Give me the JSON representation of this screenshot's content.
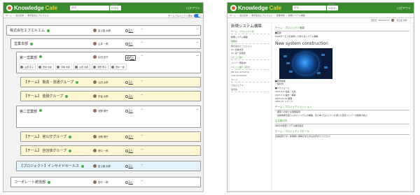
{
  "brand": {
    "name_a": "Knowledge",
    "name_b": "Cafe"
  },
  "header": {
    "search_ph": "検索",
    "filter": "組織全体検索 ▾",
    "login": "ログアウト"
  },
  "left": {
    "crumbs": [
      "ホーム",
      "会社全体",
      "株式会社エフエルエム"
    ],
    "toggle_label": "チームプロジェクト表示",
    "rows": [
      {
        "name": "株式会社エフエルエム",
        "user": "富士森 太郎",
        "count": "2人"
      },
      {
        "name": "営業本部",
        "user": "山本 一郎",
        "count": "6人"
      },
      {
        "name": "第一営業部",
        "user": "山田 花子",
        "count": "6人"
      },
      {
        "name": "【チーム】 製造・流通グループ",
        "user": "山田 太郎",
        "count": "3人"
      },
      {
        "name": "【チーム】 金融グループ",
        "user": "宇留 太郎",
        "count": "3人"
      },
      {
        "name": "第二営業部",
        "user": "河野 博子",
        "count": "3人"
      },
      {
        "name": "【チーム】 官公庁グループ",
        "user": "河野 博子",
        "count": "2人"
      },
      {
        "name": "【チーム】 自治体グループ",
        "user": "田中 一郎",
        "count": "2人"
      },
      {
        "name": "【プロジェクト】インサイドセールス",
        "user": "富士森 太郎",
        "count": "2人"
      },
      {
        "name": "コーポレート統括部",
        "user": "田中 一郎",
        "count": "3人"
      }
    ],
    "members": [
      "山田 花子",
      "田中 太郎",
      "宇留 太郎",
      "山田 太郎",
      "河野 博子",
      "田中 一郎"
    ]
  },
  "right": {
    "crumbs": [
      "ホーム",
      "会社全体",
      "株式会社エフエルエム",
      "営業本部",
      "新規システム構築"
    ],
    "meta": {
      "updated": "更新日: 2022/04/07",
      "user": "富士森 太郎"
    },
    "title": "新規システム構築",
    "side": {
      "team_lbl": "チーム・プロジェクト名",
      "team_val": "新規システム構築",
      "org_lbl": "組織名",
      "org_vals": [
        "株式会社エフエルエム",
        "(D) 営業本部",
        "(D) 第一営業部"
      ],
      "who_lbl": "ひとこと紹介",
      "member_lbl": "メンバー募集中!",
      "about_lbl": "ひとこと紹介 (英文)",
      "about_vals": [
        "We are recruiting",
        "new members!"
      ],
      "type_lbl": "タイプ",
      "type_val": "プロジェクト",
      "status_lbl": "事例等"
    },
    "main": {
      "sec1": "チーム・プロジェクト概要",
      "purpose_h": "■目的",
      "purpose": "SaaSサービスを提供した新たなシステム構築",
      "big": "New system construction",
      "period_h": "■利用技術",
      "period": "・検討中",
      "sched_h": "■スケジュール",
      "sched": [
        "2023.4-6 企画・立案",
        "2023.7-9 設計・構築",
        "2023.10-12 開発",
        "2024.01 リリース"
      ],
      "sec2": "チーム・プロジェクトミッション",
      "mission": [
        "・顧客への新たな価値提供",
        "・最新技術を取り入れたシステムの構築、及び本プロジェクトを通じた若手メンバーの技術力向上"
      ],
      "sec3": "主な取引先",
      "partner": "ABCDE情報システム株式会社",
      "sec4": "チーム・プロジェクトアピール",
      "appeal": "企画段階です！新規者に興味がある方はお声がけください！"
    }
  }
}
